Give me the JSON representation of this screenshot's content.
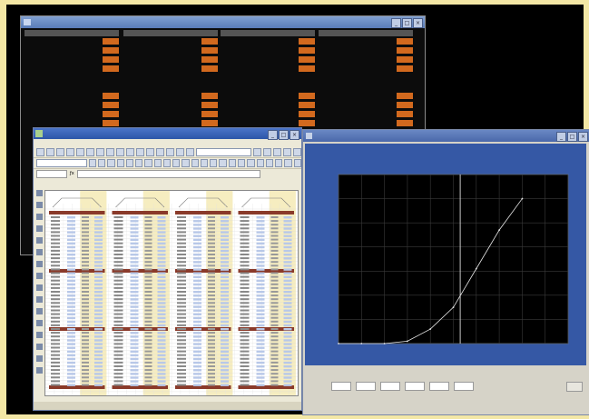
{
  "terminal": {
    "title": "",
    "columns": [
      {
        "header": "",
        "rows": [
          {
            "label": "",
            "value": ""
          },
          {
            "label": "",
            "value": ""
          },
          {
            "label": "",
            "value": ""
          },
          {
            "label": "",
            "value": ""
          },
          {
            "label": "",
            "value": ""
          },
          {
            "label": "",
            "value": ""
          },
          {
            "label": "",
            "value": ""
          },
          {
            "label": "",
            "value": ""
          },
          {
            "label": "",
            "value": ""
          },
          {
            "label": "",
            "value": ""
          }
        ]
      },
      {
        "header": "",
        "rows": [
          {
            "label": "",
            "value": ""
          },
          {
            "label": "",
            "value": ""
          },
          {
            "label": "",
            "value": ""
          },
          {
            "label": "",
            "value": ""
          },
          {
            "label": "",
            "value": ""
          },
          {
            "label": "",
            "value": ""
          },
          {
            "label": "",
            "value": ""
          },
          {
            "label": "",
            "value": ""
          },
          {
            "label": "",
            "value": ""
          },
          {
            "label": "",
            "value": ""
          }
        ]
      },
      {
        "header": "",
        "rows": [
          {
            "label": "",
            "value": ""
          },
          {
            "label": "",
            "value": ""
          },
          {
            "label": "",
            "value": ""
          },
          {
            "label": "",
            "value": ""
          },
          {
            "label": "",
            "value": ""
          },
          {
            "label": "",
            "value": ""
          },
          {
            "label": "",
            "value": ""
          },
          {
            "label": "",
            "value": ""
          },
          {
            "label": "",
            "value": ""
          },
          {
            "label": "",
            "value": ""
          }
        ]
      },
      {
        "header": "",
        "rows": [
          {
            "label": "",
            "value": ""
          },
          {
            "label": "",
            "value": ""
          },
          {
            "label": "",
            "value": ""
          },
          {
            "label": "",
            "value": ""
          },
          {
            "label": "",
            "value": ""
          },
          {
            "label": "",
            "value": ""
          },
          {
            "label": "",
            "value": ""
          },
          {
            "label": "",
            "value": ""
          },
          {
            "label": "",
            "value": ""
          },
          {
            "label": "",
            "value": ""
          }
        ]
      }
    ],
    "value_color": "#d2691e",
    "highlight_color": "#6ddc6d"
  },
  "spreadsheet": {
    "title": "",
    "menu": [
      "",
      "",
      "",
      "",
      "",
      "",
      "",
      "",
      ""
    ],
    "status": [
      "",
      "",
      "",
      ""
    ],
    "header_color": "#8a3a2a",
    "col_tint": "#f6edc0",
    "cell_tint": "#b8c8e8"
  },
  "chart_window": {
    "title": "",
    "buttons": [
      "",
      "",
      "",
      "",
      "",
      ""
    ],
    "close_label": "",
    "status_left": "",
    "status_right": "",
    "panel_color": "#3558a5",
    "plot_color": "#000000",
    "grid_color": "#3a3a3a",
    "line_color": "#e8e8e8"
  },
  "chart_data": {
    "type": "line",
    "title": "",
    "xlabel": "",
    "ylabel": "",
    "xlim": [
      0,
      10
    ],
    "ylim": [
      0,
      7
    ],
    "grid": true,
    "marker_x": 5.3,
    "series": [
      {
        "x": [
          0,
          1,
          2,
          3,
          4,
          5,
          6,
          7,
          8
        ],
        "y": [
          0,
          0,
          0,
          0.1,
          0.6,
          1.5,
          3.1,
          4.7,
          6.0
        ]
      }
    ]
  }
}
